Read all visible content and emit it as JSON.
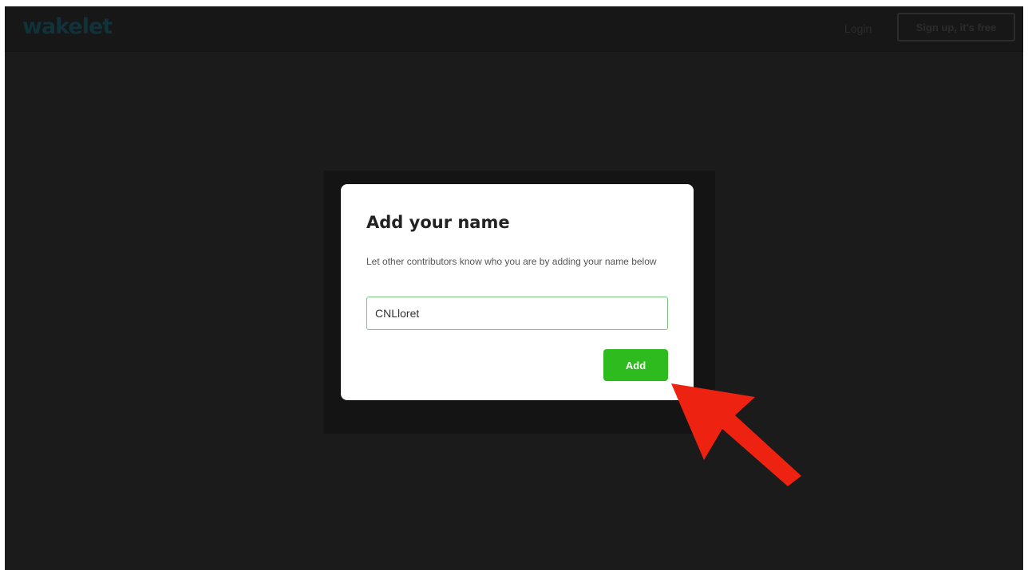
{
  "header": {
    "logo_text": "wakelet",
    "login_label": "Login",
    "signup_label": "Sign up, it's free"
  },
  "modal": {
    "title": "Add your name",
    "description": "Let other contributors know who you are by adding your name below",
    "name_value": "CNLloret",
    "add_label": "Add"
  },
  "colors": {
    "overlay": "#1b1b1b",
    "accent_green": "#2dbb1d",
    "annotation_red": "#ee2211"
  }
}
